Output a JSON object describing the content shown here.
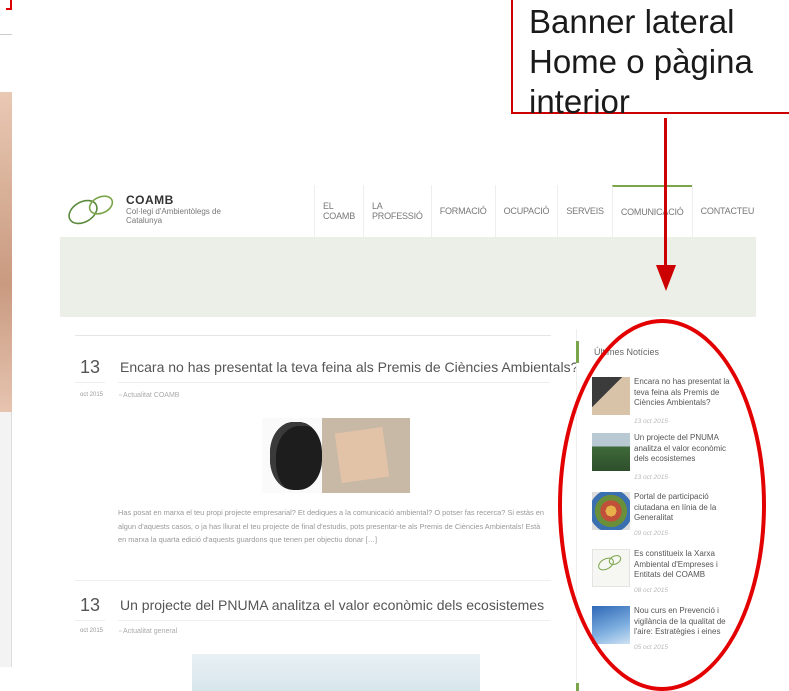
{
  "callout": {
    "lines": [
      "Banner lateral",
      "Home o pàgina",
      "interior"
    ]
  },
  "site": {
    "logo_name": "COAMB",
    "logo_sub": "Col·legi d'Ambientòlegs de Catalunya",
    "accent_color": "#7aa54a",
    "annotation_color": "#cc0000"
  },
  "nav": {
    "items": [
      "EL COAMB",
      "LA PROFESSIÓ",
      "FORMACIÓ",
      "OCUPACIÓ",
      "SERVEIS",
      "COMUNICACIÓ",
      "CONTACTEU"
    ],
    "active": "COMUNICACIÓ"
  },
  "posts": [
    {
      "day": "13",
      "month": "oct 2015",
      "title": "Encara no has presentat la teva feina als Premis de Ciències Ambientals?",
      "category": "Actualitat COAMB",
      "excerpt": "Has posat en marxa el teu propi projecte empresarial? Et dediques a la comunicació ambiental? O potser fas recerca? Si estàs en algun d'aquests casos, o ja has lliurat el teu projecte de final d'estudis, pots presentar-te als Premis de Ciències Ambientals! Està en marxa la quarta edició d'aquests guardons que tenen per objectiu donar […]"
    },
    {
      "day": "13",
      "month": "oct 2015",
      "title": "Un projecte del PNUMA analitza el valor econòmic dels ecosistemes",
      "category": "Actualitat general"
    }
  ],
  "sidebar": {
    "title": "Últimes Notícies",
    "items": [
      {
        "title": "Encara no has presentat la teva feina als Premis de Ciències Ambientals?",
        "date": "13 oct 2015"
      },
      {
        "title": "Un projecte del PNUMA analitza el valor econòmic dels ecosistemes",
        "date": "13 oct 2015"
      },
      {
        "title": "Portal de participació ciutadana en línia de la Generalitat",
        "date": "09 oct 2015"
      },
      {
        "title": "Es constitueix la Xarxa Ambiental d'Empreses i Entitats del COAMB",
        "date": "08 oct 2015"
      },
      {
        "title": "Nou curs en Prevenció i vigilància de la qualitat de l'aire: Estratègies i eines",
        "date": "05 oct 2015"
      }
    ]
  }
}
